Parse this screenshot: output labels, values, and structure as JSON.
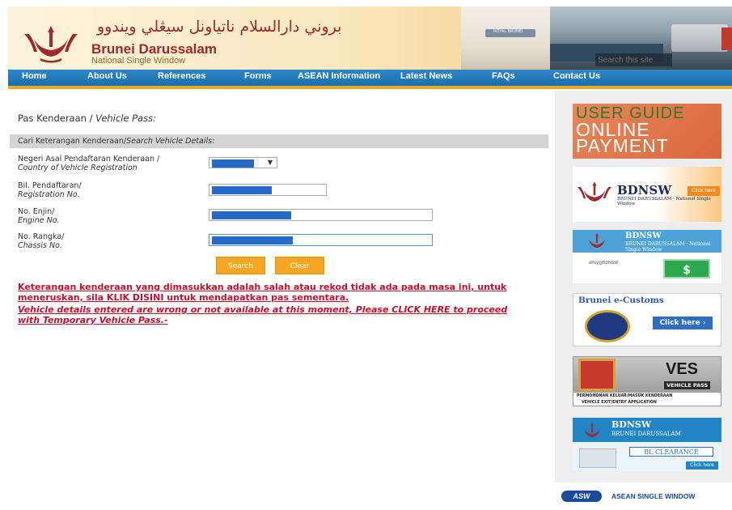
{
  "header": {
    "arabic_title": "بروني دارالسلام ناتياونل سيڠلي ويندوو",
    "brand": "Brunei Darussalam",
    "subtitle": "National Single Window",
    "search_placeholder": "Search this site",
    "plane_tag": "ROYAL BRUNEI"
  },
  "nav": {
    "items": [
      "Home",
      "About Us",
      "References",
      "Forms",
      "ASEAN Information",
      "Latest News",
      "FAQs",
      "Contact Us"
    ]
  },
  "main": {
    "title": "Pas Kenderaan / ",
    "title_en": "Vehicle Pass:",
    "search_bar": "Cari Keterangan Kenderaan/",
    "search_bar_en": "Search Vehicle Details:",
    "fields": [
      {
        "label_ms": "Negeri Asal Pendaftaran Kenderaan /",
        "label_en": "Country of Vehicle Registration"
      },
      {
        "label_ms": "Bil. Pendaftaran/",
        "label_en": "Registration No."
      },
      {
        "label_ms": "No. Enjin/",
        "label_en": "Engine No."
      },
      {
        "label_ms": "No. Rangka/",
        "label_en": "Chassis No."
      }
    ],
    "search_button": "Search",
    "clear_button": "Clear",
    "notice_ms_1": "Keterangan kenderaan yang dimasukkan adalah salah atau rekod tidak ada pada masa ini, untuk",
    "notice_ms_2": "meneruskan, sila KLIK DISINI untuk mendapatkan pas sementara.",
    "notice_en_1": "Vehicle details entered are wrong or not available at this moment, Please CLICK HERE to proceed",
    "notice_en_2": "with Temporary Vehicle Pass.-"
  },
  "sidebar": {
    "user_guide": {
      "line1": "USER GUIDE",
      "line2": "ONLINE",
      "line3": "PAYMENT"
    },
    "bdnsw1": {
      "title": "BDNSW",
      "sub": "BRUNEI DARUSSALAM · National Single Window",
      "click": "Click here"
    },
    "bdnsw2": {
      "title": "BDNSW",
      "sub": "BRUNEI DARUSSALAM · National Single Window",
      "epay": "ePay@BDNSW",
      "money": "$"
    },
    "ecustoms": {
      "title": "Brunei e-Customs",
      "click": "Click here ›"
    },
    "ves": {
      "title": "VES",
      "vehicle_pass": "VEHICLE PASS",
      "line1": "PERMOHONAN KELUAR/MASUK KENDERAAN",
      "line2": "VEHICLE EXIT/ENTRY APPLICATION"
    },
    "bdnsw3": {
      "title": "BDNSW",
      "sub": "BRUNEI DARUSSALAM",
      "bl": "BL CLEARANCE",
      "click": "Click here"
    },
    "asw": {
      "logo": "ASW",
      "text": "ASEAN SINGLE WINDOW"
    }
  },
  "colors": {
    "nav": "#1a6fae",
    "accent": "#f5a623",
    "notice": "#c8102e",
    "brand": "#a0292b"
  }
}
